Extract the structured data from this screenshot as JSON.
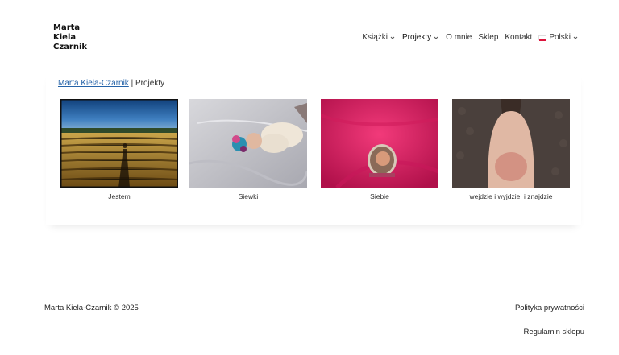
{
  "logo": {
    "line1": "Marta",
    "line2": "Kiela",
    "line3": "Czarnik"
  },
  "nav": {
    "items": [
      {
        "label": "Książki",
        "dropdown": true
      },
      {
        "label": "Projekty",
        "dropdown": true
      },
      {
        "label": "O mnie",
        "dropdown": false
      },
      {
        "label": "Sklep",
        "dropdown": false
      },
      {
        "label": "Kontakt",
        "dropdown": false
      }
    ],
    "language": {
      "label": "Polski",
      "flag": "poland-flag-icon"
    }
  },
  "breadcrumb": {
    "home": "Marta Kiela-Czarnik",
    "separator": "|",
    "current": "Projekty"
  },
  "projects": [
    {
      "caption": "Jestem",
      "icon": "field-shadow-photo"
    },
    {
      "caption": "Siewki",
      "icon": "lying-figure-photo"
    },
    {
      "caption": "Siebie",
      "icon": "mirror-pink-photo"
    },
    {
      "caption": "wejdzie i wyjdzie, i znajdzie",
      "icon": "back-mark-photo"
    }
  ],
  "footer": {
    "copyright": "Marta Kiela-Czarnik © 2025",
    "privacy": "Polityka prywatności",
    "terms": "Regulamin sklepu"
  },
  "colors": {
    "link": "#2563a8",
    "flag_red": "#dc143c"
  }
}
